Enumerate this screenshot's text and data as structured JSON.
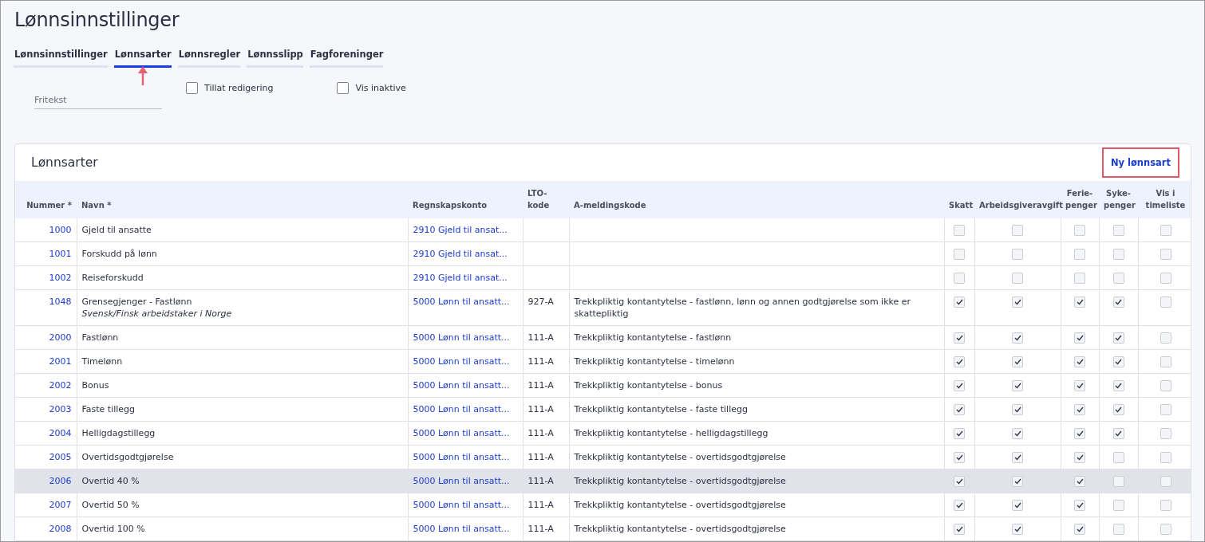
{
  "title": "Lønnsinnstillinger",
  "tabs": [
    {
      "label": "Lønnsinnstillinger",
      "selected": false,
      "pointed": false
    },
    {
      "label": "Lønnsarter",
      "selected": true,
      "pointed": true
    },
    {
      "label": "Lønnsregler",
      "selected": false,
      "pointed": false
    },
    {
      "label": "Lønnsslipp",
      "selected": false,
      "pointed": false
    },
    {
      "label": "Fagforeninger",
      "selected": false,
      "pointed": false
    }
  ],
  "filters": {
    "search": {
      "placeholder": "Fritekst"
    },
    "checkboxes": [
      {
        "label": "Tillat redigering",
        "checked": false
      },
      {
        "label": "Vis inaktive",
        "checked": false
      }
    ]
  },
  "card": {
    "title": "Lønnsarter",
    "new_button": {
      "label": "Ny lønnsart",
      "outlined": true
    },
    "columns": [
      [
        "Nummer *"
      ],
      [
        "Navn *"
      ],
      [
        "Regnskapskonto"
      ],
      [
        "LTO-",
        "kode"
      ],
      [
        "A-meldingskode"
      ],
      [
        "Skatt"
      ],
      [
        "Arbeidsgiveravgift"
      ],
      [
        "Ferie-",
        "penger"
      ],
      [
        "Syke-",
        "penger"
      ],
      [
        "Vis i",
        "timeliste"
      ]
    ],
    "rows": [
      {
        "number": "1000",
        "name": "Gjeld til ansatte",
        "account": "2910 Gjeld til ansat...",
        "lto": "",
        "amelding": "",
        "flags": [
          false,
          false,
          false,
          false,
          false
        ],
        "hovered": false
      },
      {
        "number": "1001",
        "name": "Forskudd på lønn",
        "account": "2910 Gjeld til ansat...",
        "lto": "",
        "amelding": "",
        "flags": [
          false,
          false,
          false,
          false,
          false
        ],
        "hovered": false
      },
      {
        "number": "1002",
        "name": "Reiseforskudd",
        "account": "2910 Gjeld til ansat...",
        "lto": "",
        "amelding": "",
        "flags": [
          false,
          false,
          false,
          false,
          false
        ],
        "hovered": false
      },
      {
        "number": "1048",
        "name": "Grensegjenger - Fastlønn",
        "note": "Svensk/Finsk arbeidstaker i Norge",
        "account": "5000 Lønn til ansatt...",
        "lto": "927-A",
        "amelding": "Trekkpliktig kontantytelse - fastlønn, lønn og annen godtgjørelse som ikke er skattepliktig",
        "flags": [
          true,
          true,
          true,
          true,
          false
        ],
        "hovered": false
      },
      {
        "number": "2000",
        "name": "Fastlønn",
        "account": "5000 Lønn til ansatt...",
        "lto": "111-A",
        "amelding": "Trekkpliktig kontantytelse - fastlønn",
        "flags": [
          true,
          true,
          true,
          true,
          false
        ],
        "hovered": false
      },
      {
        "number": "2001",
        "name": "Timelønn",
        "account": "5000 Lønn til ansatt...",
        "lto": "111-A",
        "amelding": "Trekkpliktig kontantytelse - timelønn",
        "flags": [
          true,
          true,
          true,
          true,
          false
        ],
        "hovered": false
      },
      {
        "number": "2002",
        "name": "Bonus",
        "account": "5000 Lønn til ansatt...",
        "lto": "111-A",
        "amelding": "Trekkpliktig kontantytelse - bonus",
        "flags": [
          true,
          true,
          true,
          true,
          false
        ],
        "hovered": false
      },
      {
        "number": "2003",
        "name": "Faste tillegg",
        "account": "5000 Lønn til ansatt...",
        "lto": "111-A",
        "amelding": "Trekkpliktig kontantytelse - faste tillegg",
        "flags": [
          true,
          true,
          true,
          true,
          false
        ],
        "hovered": false
      },
      {
        "number": "2004",
        "name": "Helligdagstillegg",
        "account": "5000 Lønn til ansatt...",
        "lto": "111-A",
        "amelding": "Trekkpliktig kontantytelse - helligdagstillegg",
        "flags": [
          true,
          true,
          true,
          true,
          false
        ],
        "hovered": false
      },
      {
        "number": "2005",
        "name": "Overtidsgodtgjørelse",
        "account": "5000 Lønn til ansatt...",
        "lto": "111-A",
        "amelding": "Trekkpliktig kontantytelse - overtidsgodtgjørelse",
        "flags": [
          true,
          true,
          true,
          false,
          false
        ],
        "hovered": false
      },
      {
        "number": "2006",
        "name": "Overtid 40 %",
        "account": "5000 Lønn til ansatt...",
        "lto": "111-A",
        "amelding": "Trekkpliktig kontantytelse - overtidsgodtgjørelse",
        "flags": [
          true,
          true,
          true,
          false,
          false
        ],
        "hovered": true
      },
      {
        "number": "2007",
        "name": "Overtid 50 %",
        "account": "5000 Lønn til ansatt...",
        "lto": "111-A",
        "amelding": "Trekkpliktig kontantytelse - overtidsgodtgjørelse",
        "flags": [
          true,
          true,
          true,
          false,
          false
        ],
        "hovered": false
      },
      {
        "number": "2008",
        "name": "Overtid 100 %",
        "account": "5000 Lønn til ansatt...",
        "lto": "111-A",
        "amelding": "Trekkpliktig kontantytelse - overtidsgodtgjørelse",
        "flags": [
          true,
          true,
          true,
          false,
          false
        ],
        "hovered": false
      }
    ]
  }
}
